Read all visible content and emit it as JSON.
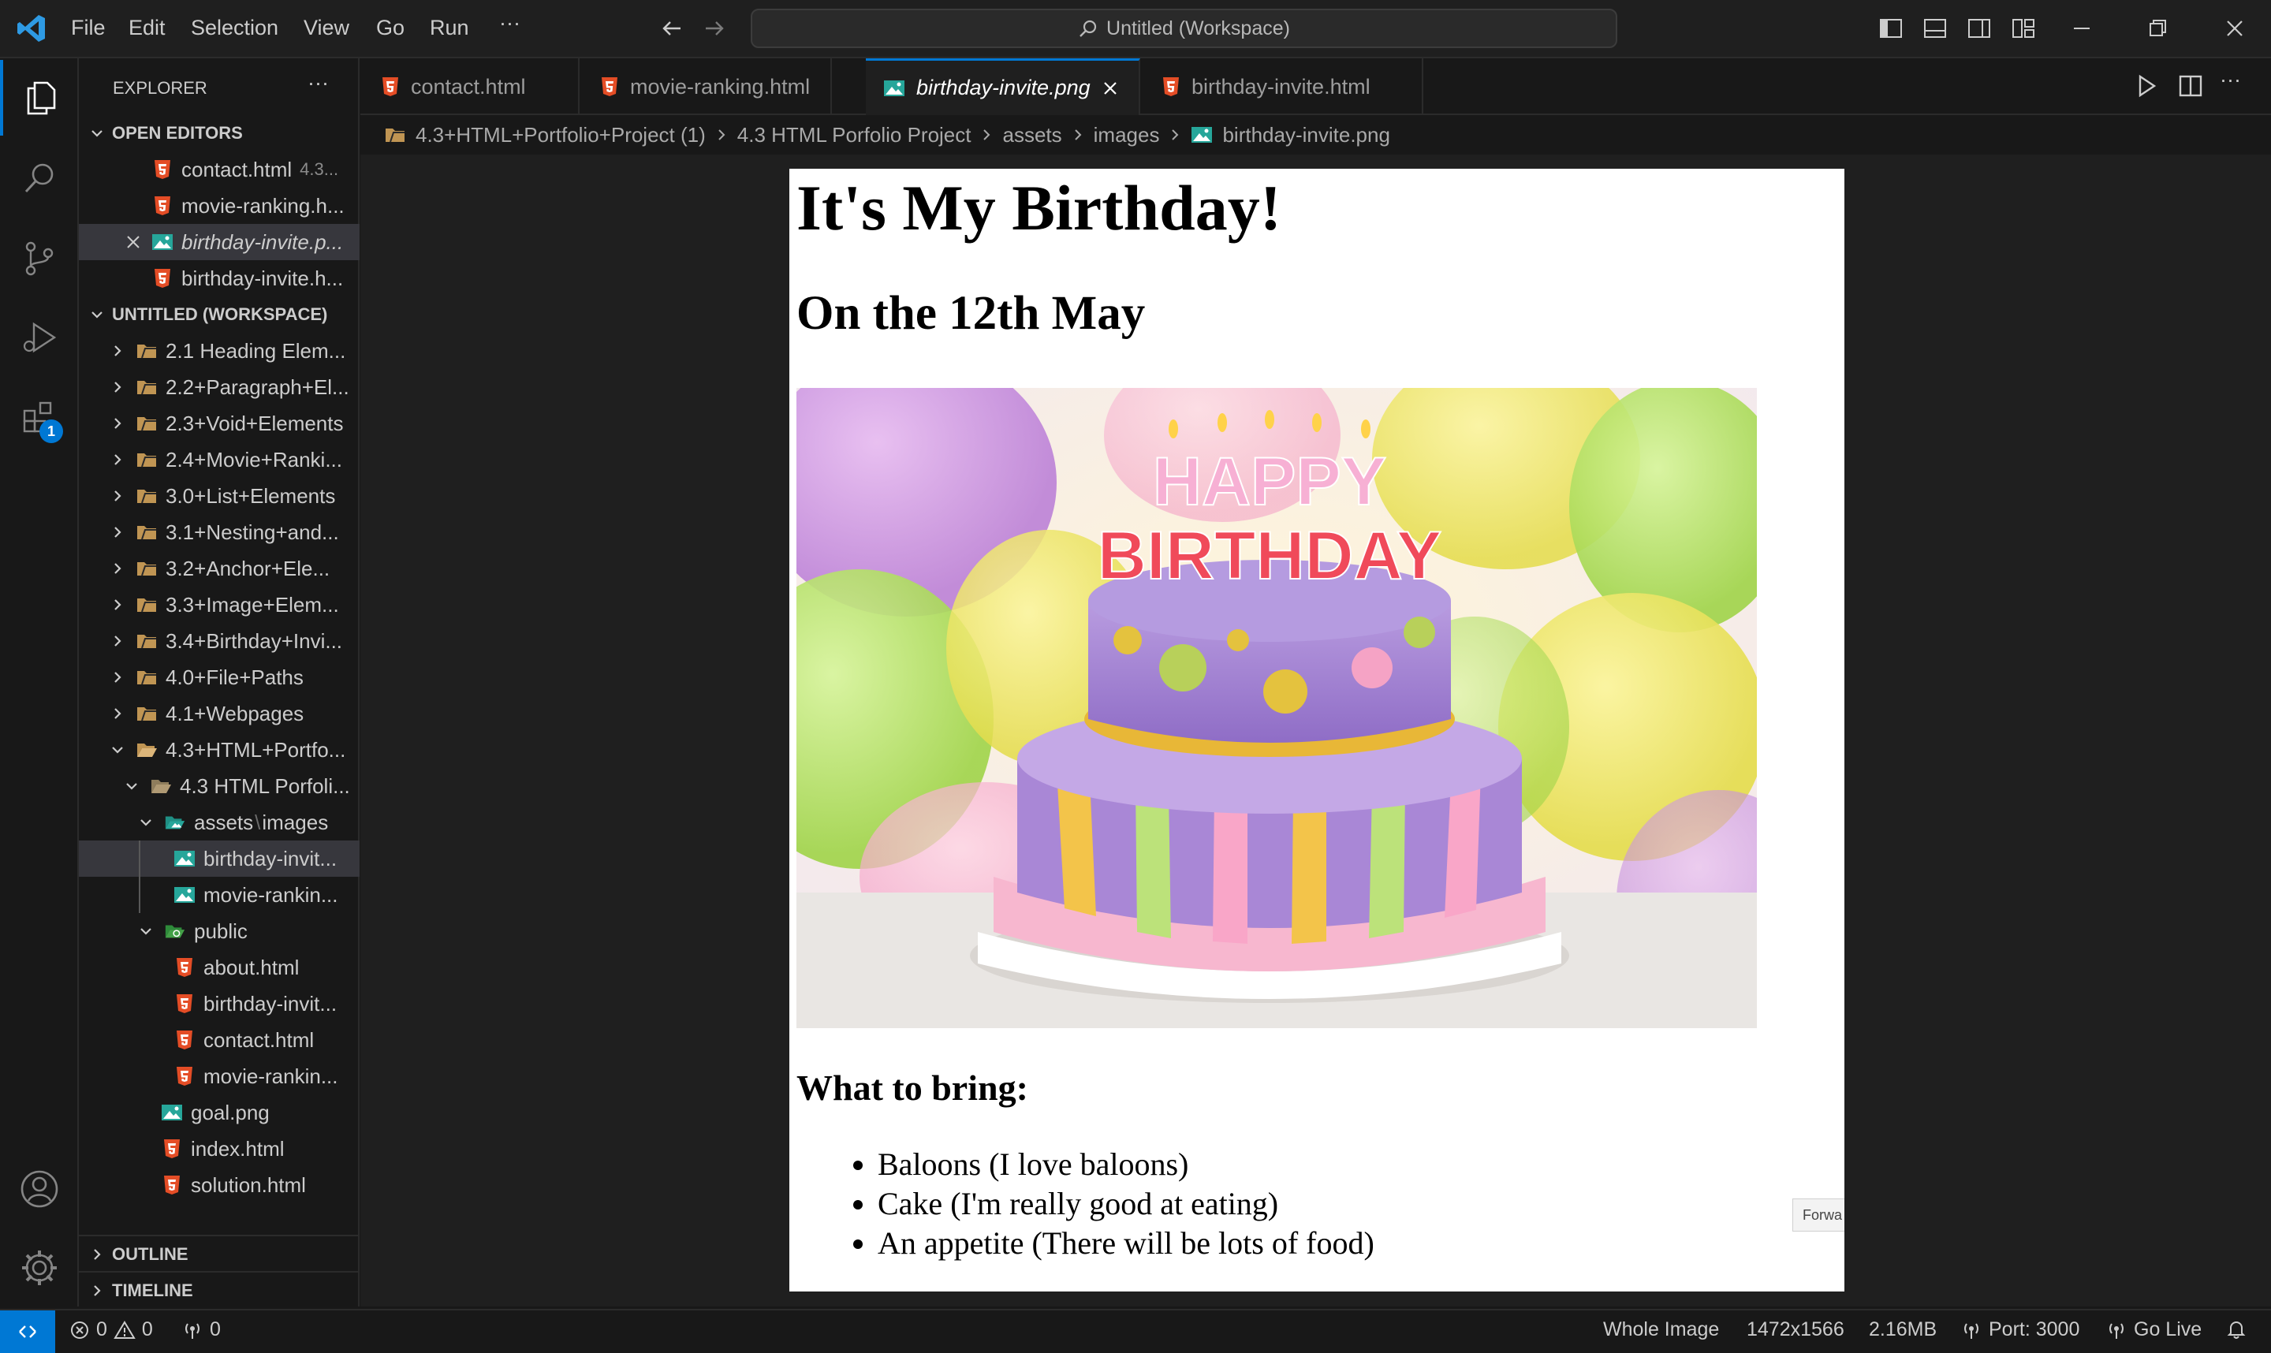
{
  "titlebar": {
    "menu": [
      "File",
      "Edit",
      "Selection",
      "View",
      "Go",
      "Run",
      "···"
    ],
    "command_center": "Untitled (Workspace)"
  },
  "activity_bar": {
    "extensions_badge": "1"
  },
  "sidebar": {
    "title": "EXPLORER",
    "more": "···",
    "open_editors_header": "OPEN EDITORS",
    "open_editors": [
      {
        "name": "contact.html",
        "hint": "4.3..."
      },
      {
        "name": "movie-ranking.h..."
      },
      {
        "name": "birthday-invite.p..."
      },
      {
        "name": "birthday-invite.h..."
      }
    ],
    "workspace_header": "UNTITLED (WORKSPACE)",
    "tree": [
      "2.1 Heading Elem...",
      "2.2+Paragraph+El...",
      "2.3+Void+Elements",
      "2.4+Movie+Ranki...",
      "3.0+List+Elements",
      "3.1+Nesting+and...",
      "3.2+Anchor+Ele...",
      "3.3+Image+Elem...",
      "3.4+Birthday+Invi...",
      "4.0+File+Paths",
      "4.1+Webpages",
      "4.3+HTML+Portfo...",
      "4.3 HTML Porfoli...",
      "assets",
      "images",
      "birthday-invit...",
      "movie-rankin...",
      "public",
      "about.html",
      "birthday-invit...",
      "contact.html",
      "movie-rankin...",
      "goal.png",
      "index.html",
      "solution.html"
    ],
    "outline_header": "OUTLINE",
    "timeline_header": "TIMELINE"
  },
  "tabs": [
    {
      "label": "contact.html"
    },
    {
      "label": "movie-ranking.html"
    },
    {
      "label": "birthday-invite.png"
    },
    {
      "label": "birthday-invite.html"
    }
  ],
  "breadcrumb": [
    "4.3+HTML+Portfolio+Project (1)",
    "4.3 HTML Porfolio Project",
    "assets",
    "images",
    "birthday-invite.png"
  ],
  "image": {
    "h1": "It's My Birthday!",
    "h2": "On the 12th May",
    "cake_top_text": "HAPPY",
    "cake_bottom_text": "BIRTHDAY",
    "h3": "What to bring:",
    "items": [
      "Baloons (I love baloons)",
      "Cake (I'm really good at eating)",
      "An appetite (There will be lots of food)"
    ],
    "tooltip": "Forwa"
  },
  "statusbar": {
    "errors": "0",
    "warnings": "0",
    "ports": "0",
    "zoom": "Whole Image",
    "dimensions": "1472x1566",
    "size": "2.16MB",
    "port": "Port: 3000",
    "golive": "Go Live"
  },
  "colors": {
    "accent": "#0078d4",
    "html_icon": "#e44d26",
    "image_icon": "#26a69a",
    "folder": "#c09553"
  }
}
